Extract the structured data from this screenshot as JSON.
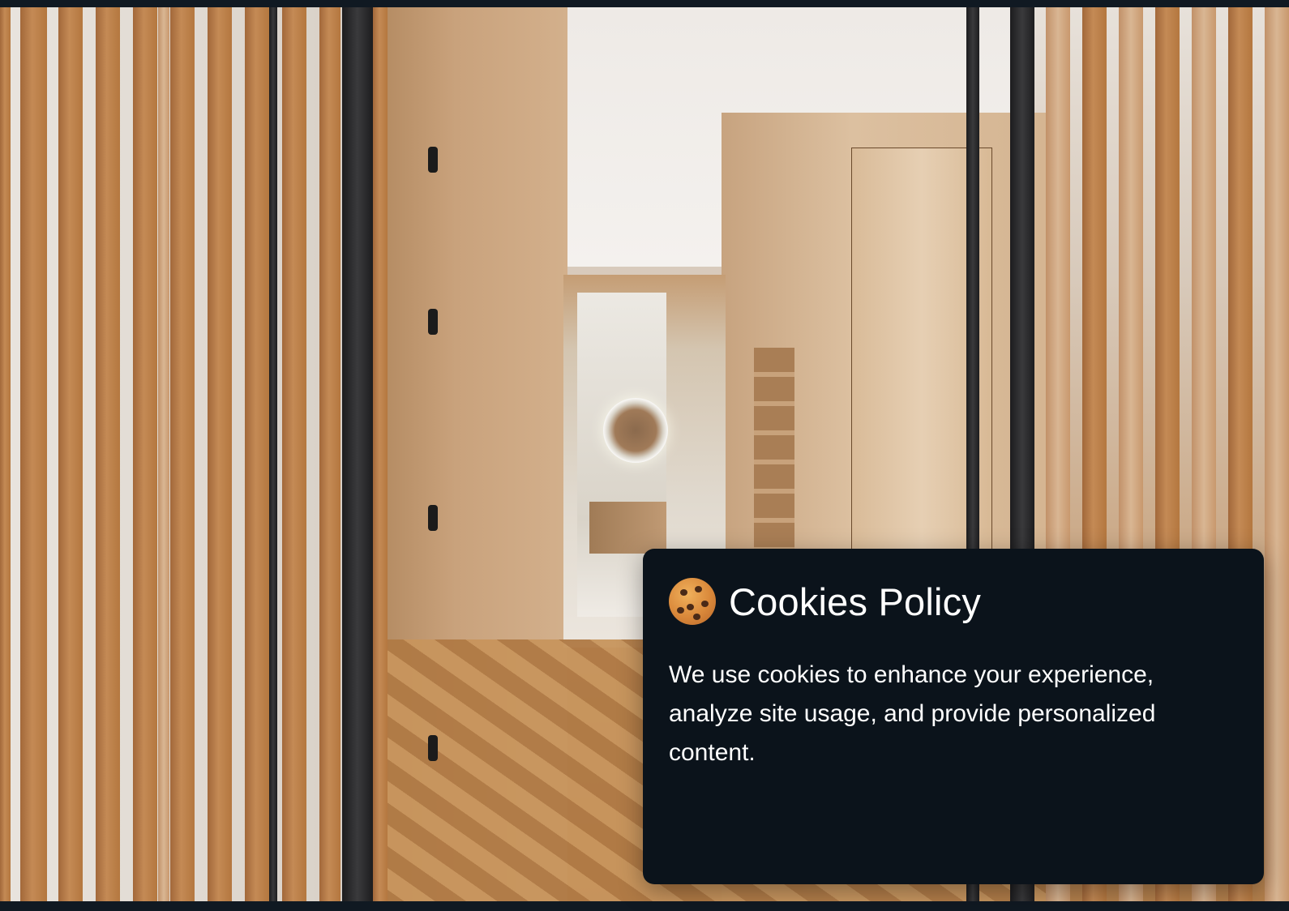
{
  "cookie_banner": {
    "icon": "cookie-icon",
    "title": "Cookies Policy",
    "message": "We use cookies to enhance your experience, analyze site usage, and provide personalized content."
  },
  "background": {
    "image": "wood-slat-hallway-photo"
  },
  "colors": {
    "dialog_background": "#0b131b",
    "dialog_text": "#ffffff",
    "frame_bar": "#101922"
  }
}
